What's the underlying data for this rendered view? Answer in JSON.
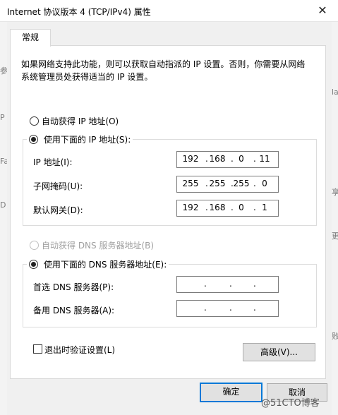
{
  "window": {
    "title": "Internet 协议版本 4 (TCP/IPv4) 属性"
  },
  "tabs": [
    {
      "label": "常规"
    }
  ],
  "description": "如果网络支持此功能，则可以获取自动指派的 IP 设置。否则，你需要从网络系统管理员处获得适当的 IP 设置。",
  "ip_mode": {
    "auto_label": "自动获得 IP 地址(O)",
    "manual_label": "使用下面的 IP 地址(S):",
    "selected": "manual",
    "fields": [
      {
        "label": "IP 地址(I):",
        "octets": [
          "192",
          "168",
          "0",
          "11"
        ]
      },
      {
        "label": "子网掩码(U):",
        "octets": [
          "255",
          "255",
          "255",
          "0"
        ]
      },
      {
        "label": "默认网关(D):",
        "octets": [
          "192",
          "168",
          "0",
          "1"
        ]
      }
    ]
  },
  "dns_mode": {
    "auto_label": "自动获得 DNS 服务器地址(B)",
    "manual_label": "使用下面的 DNS 服务器地址(E):",
    "selected": "manual",
    "fields": [
      {
        "label": "首选 DNS 服务器(P):",
        "octets": [
          "",
          "",
          "",
          ""
        ]
      },
      {
        "label": "备用 DNS 服务器(A):",
        "octets": [
          "",
          "",
          "",
          ""
        ]
      }
    ]
  },
  "validate": {
    "label": "退出时验证设置(L)",
    "checked": false
  },
  "buttons": {
    "advanced": "高级(V)...",
    "ok": "确定",
    "cancel": "取消"
  },
  "watermark": "@51CTO博客",
  "background": {
    "left_glyphs": [
      "参",
      "P",
      "Fa",
      "D"
    ],
    "right_glyphs": [
      "la",
      "享",
      "更",
      "败"
    ]
  },
  "colors": {
    "focus_border": "#0078d7",
    "dialog_bg": "#f0f0f0",
    "panel_bg": "#ffffff"
  }
}
